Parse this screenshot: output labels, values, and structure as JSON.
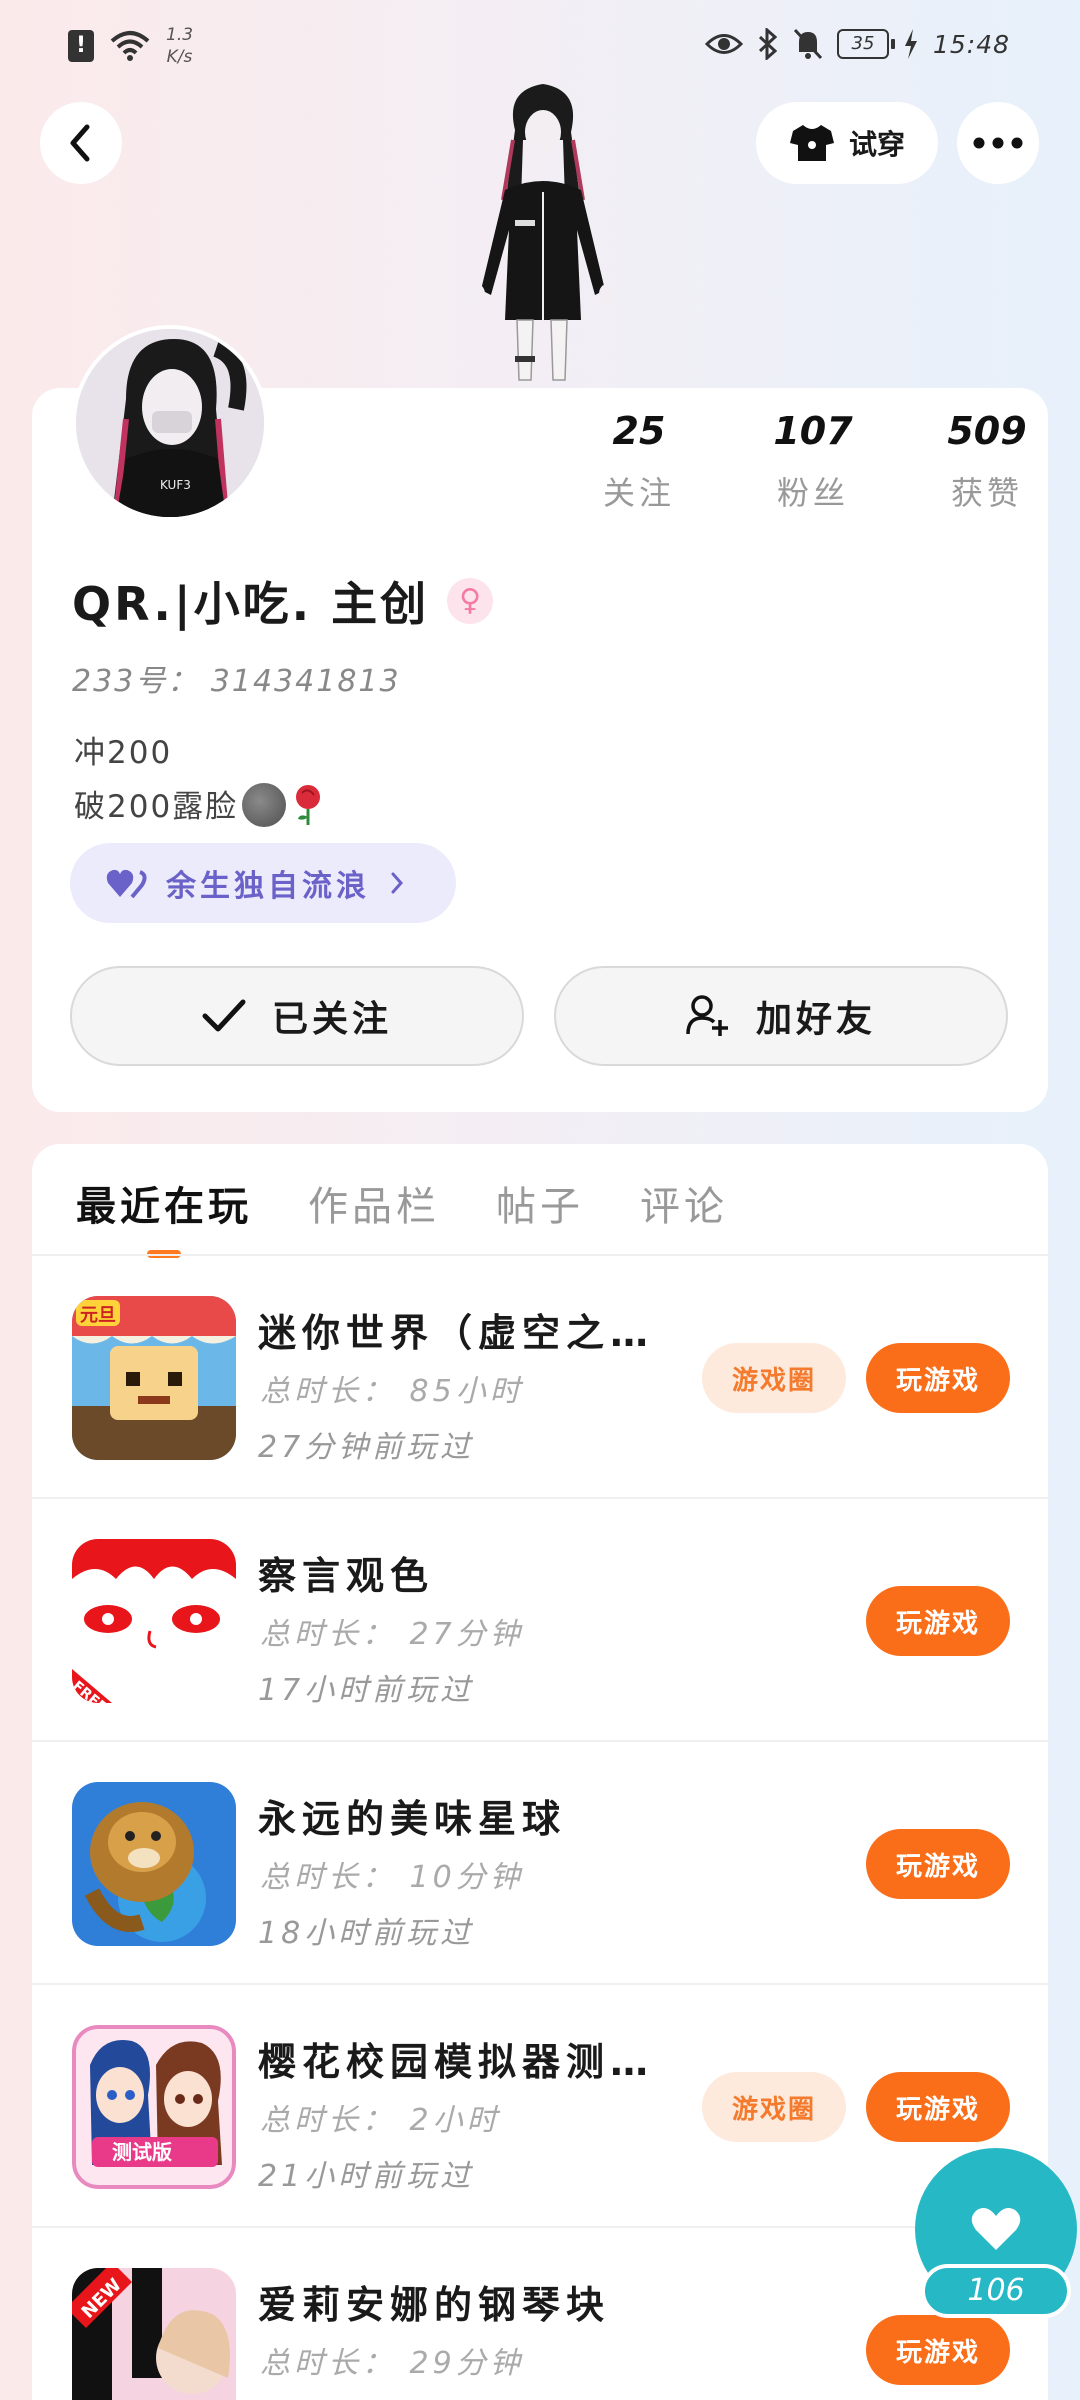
{
  "status_bar": {
    "net_speed": "1.3",
    "net_unit": "K/s",
    "battery": "35",
    "time": "15:48"
  },
  "header": {
    "tryon_label": "试穿"
  },
  "profile": {
    "stats": [
      {
        "value": "25",
        "label": "关注"
      },
      {
        "value": "107",
        "label": "粉丝"
      },
      {
        "value": "509",
        "label": "获赞"
      }
    ],
    "username": "QR.|小吃. 主创",
    "gender_symbol": "♀",
    "uid": "233号： 314341813",
    "bio_line1": "冲200",
    "bio_line2": "破200露脸",
    "group_label": "余生独自流浪",
    "follow_label": "已关注",
    "add_friend_label": "加好友"
  },
  "tabs": [
    {
      "label": "最近在玩",
      "active": true
    },
    {
      "label": "作品栏",
      "active": false
    },
    {
      "label": "帖子",
      "active": false
    },
    {
      "label": "评论",
      "active": false
    }
  ],
  "games": [
    {
      "title": "迷你世界（虚空之…",
      "duration": "总时长： 85小时",
      "last_played": "27分钟前玩过",
      "has_circle": true
    },
    {
      "title": "察言观色",
      "duration": "总时长： 27分钟",
      "last_played": "17小时前玩过",
      "has_circle": false
    },
    {
      "title": "永远的美味星球",
      "duration": "总时长： 10分钟",
      "last_played": "18小时前玩过",
      "has_circle": false
    },
    {
      "title": "樱花校园模拟器测…",
      "duration": "总时长： 2小时",
      "last_played": "21小时前玩过",
      "has_circle": true
    },
    {
      "title": "爱莉安娜的钢琴块",
      "duration": "总时长： 29分钟",
      "last_played": "",
      "has_circle": false
    }
  ],
  "buttons": {
    "circle_label": "游戏圈",
    "play_label": "玩游戏"
  },
  "like": {
    "count": "106"
  },
  "colors": {
    "accent_orange": "#fa6e1a",
    "like_teal": "#27b8c6",
    "group_purple": "#6b62c9"
  }
}
